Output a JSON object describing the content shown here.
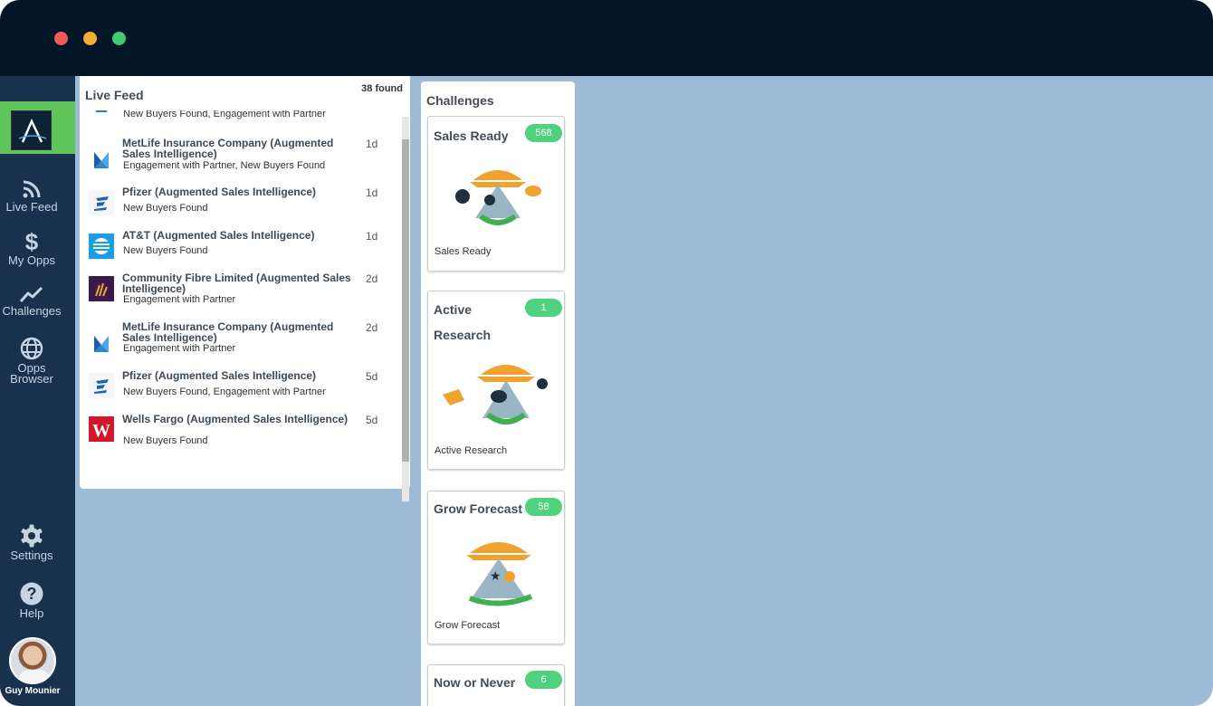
{
  "sidebar": {
    "items": [
      {
        "label": "Live Feed",
        "icon": "rss-icon"
      },
      {
        "label": "My Opps",
        "icon": "dollar-icon"
      },
      {
        "label": "Challenges",
        "icon": "trend-icon"
      },
      {
        "label_line1": "Opps",
        "label_line2": "Browser",
        "icon": "globe-icon"
      },
      {
        "label": "Settings",
        "icon": "gear-icon"
      },
      {
        "label": "Help",
        "icon": "help-icon"
      }
    ],
    "user_name": "Guy Mounier"
  },
  "feed": {
    "title": "Live Feed",
    "count": "38 found",
    "rows": [
      {
        "sub": "New Buyers Found, Engagement with Partner"
      },
      {
        "name": "MetLife Insurance Company (Augmented Sales Intelligence)",
        "sub": "Engagement with Partner, New Buyers Found",
        "time": "1d"
      },
      {
        "name": "Pfizer (Augmented Sales Intelligence)",
        "sub": "New Buyers Found",
        "time": "1d"
      },
      {
        "name": "AT&T (Augmented Sales Intelligence)",
        "sub": "New Buyers Found",
        "time": "1d"
      },
      {
        "name": "Community Fibre Limited (Augmented Sales Intelligence)",
        "sub": "Engagement with Partner",
        "time": "2d"
      },
      {
        "name": "MetLife Insurance Company (Augmented Sales Intelligence)",
        "sub": "Engagement with Partner",
        "time": "2d"
      },
      {
        "name": "Pfizer (Augmented Sales Intelligence)",
        "sub": "New Buyers Found, Engagement with Partner",
        "time": "5d"
      },
      {
        "name": "Wells Fargo (Augmented Sales Intelligence)",
        "sub": "New Buyers Found",
        "time": "5d"
      }
    ]
  },
  "challenges": {
    "title": "Challenges",
    "cards": [
      {
        "title": "Sales Ready",
        "count": "568",
        "footer": "Sales Ready"
      },
      {
        "title_line1": "Active",
        "title_line2": "Research",
        "count": "1",
        "footer": "Active Research"
      },
      {
        "title": "Grow Forecast",
        "count": "58",
        "footer": "Grow Forecast"
      },
      {
        "title": "Now or Never",
        "count": "6"
      }
    ]
  },
  "colors": {
    "titlebar": "#031628",
    "sidebar": "#18324e",
    "accent_green": "#5fc45a",
    "badge": "#4fd17e",
    "canvas": "#9dbbd6"
  }
}
